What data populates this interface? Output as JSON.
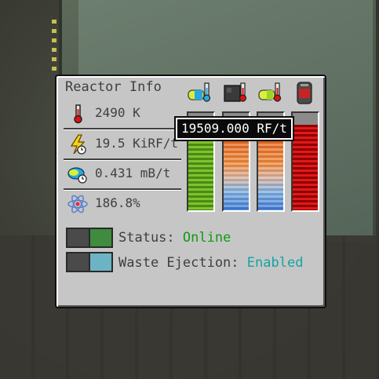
{
  "panel": {
    "title": "Reactor Info"
  },
  "stats": [
    {
      "icon": "thermometer-icon",
      "value": "2490 K"
    },
    {
      "icon": "lightning-icon",
      "value": "19.5 KiRF/t"
    },
    {
      "icon": "fuel-rate-icon",
      "value": "0.431 mB/t"
    },
    {
      "icon": "atom-icon",
      "value": "186.8%"
    }
  ],
  "gauges": [
    {
      "icon": "fuel-heat-icon",
      "level": 0.88,
      "color": "#6fb52a"
    },
    {
      "icon": "casing-heat-icon",
      "level": 0.88,
      "color": "#f08a3a"
    },
    {
      "icon": "fuel-temp-icon",
      "level": 0.88,
      "color": "#f08a3a"
    },
    {
      "icon": "energy-cell-icon",
      "level": 0.88,
      "color": "#e01a1a"
    }
  ],
  "tooltip": {
    "text": "19509.000 RF/t"
  },
  "status": {
    "label": "Status:",
    "value": "Online",
    "value_color": "#0f9a0f",
    "toggle_color": "#3f8b3f"
  },
  "waste": {
    "label": "Waste Ejection:",
    "value": "Enabled",
    "value_color": "#14a3a3",
    "toggle_color": "#6cb4c4"
  }
}
